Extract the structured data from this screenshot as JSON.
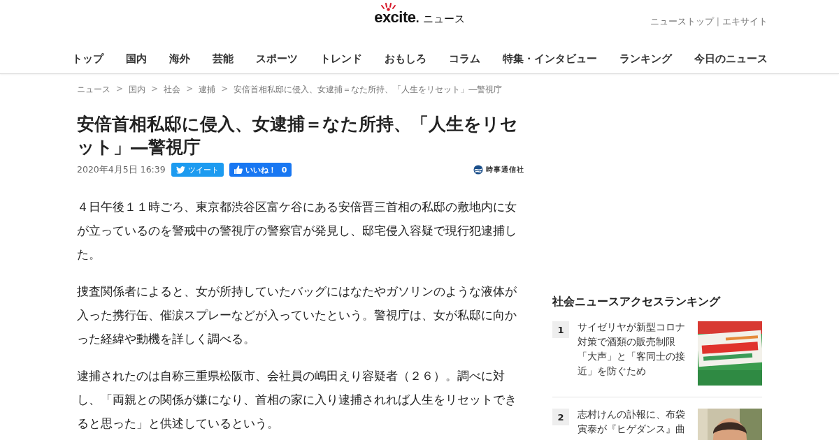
{
  "header": {
    "logo": {
      "brand": "excite",
      "mark": ".",
      "section": "ニュース"
    },
    "top_links": [
      {
        "label": "ニューストップ"
      },
      {
        "separator": "|",
        "label": "エキサイト"
      }
    ],
    "nav": [
      "トップ",
      "国内",
      "海外",
      "芸能",
      "スポーツ",
      "トレンド",
      "おもしろ",
      "コラム",
      "特集・インタビュー",
      "ランキング",
      "今日のニュース"
    ]
  },
  "breadcrumb": [
    {
      "label": "ニュース"
    },
    {
      "separator": ">",
      "label": "国内"
    },
    {
      "separator": ">",
      "label": "社会"
    },
    {
      "separator": ">",
      "label": "逮捕"
    },
    {
      "separator": ">",
      "label": "安倍首相私邸に侵入、女逮捕＝なた所持、「人生をリセット」―警視庁"
    }
  ],
  "article": {
    "title": "安倍首相私邸に侵入、女逮捕＝なた所持、「人生をリセット」―警視庁",
    "date": "2020年4月5日 16:39",
    "tweet_button": "ツイート",
    "like_button": {
      "label": "いいね！",
      "count": "0"
    },
    "source": "時事通信社",
    "paragraphs": [
      "４日午後１１時ごろ、東京都渋谷区富ケ谷にある安倍晋三首相の私邸の敷地内に女が立っているのを警戒中の警視庁の警察官が発見し、邸宅侵入容疑で現行犯逮捕した。",
      "捜査関係者によると、女が所持していたバッグにはなたやガソリンのような液体が入った携行缶、催涙スプレーなどが入っていたという。警視庁は、女が私邸に向かった経緯や動機を詳しく調べる。",
      "逮捕されたのは自称三重県松阪市、会社員の嶋田えり容疑者（２６）。調べに対し、「両親との関係が嫌になり、首相の家に入り逮捕されれば人生をリセットできると思った」と供述しているという。"
    ]
  },
  "ranking": {
    "title": "社会ニュースアクセスランキング",
    "items": [
      {
        "rank": "1",
        "title": "サイゼリヤが新型コロナ対策で酒類の販売制限「大声」と「客同士の接近」を防ぐため",
        "kind": "sign"
      },
      {
        "rank": "2",
        "title": "志村けんの訃報に、布袋寅泰が『ヒゲダンス』曲",
        "kind": "person"
      }
    ]
  }
}
